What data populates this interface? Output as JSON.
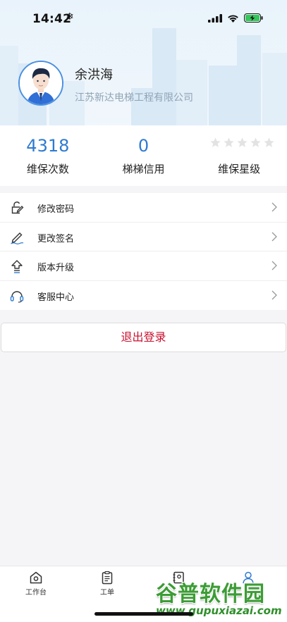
{
  "status_bar": {
    "time": "14:42",
    "extra_icon": "snowflake-icon",
    "icons": [
      "cellular-signal-icon",
      "wifi-icon",
      "battery-charging-icon"
    ]
  },
  "profile": {
    "name": "余洪海",
    "company": "江苏新达电梯工程有限公司",
    "avatar_icon": "user-avatar"
  },
  "stats": {
    "maintenance_count": {
      "value": "4318",
      "label": "维保次数"
    },
    "credit": {
      "value": "0",
      "label": "梯梯信用"
    },
    "rating": {
      "label": "维保星级",
      "stars_total": 5,
      "stars_filled": 0
    }
  },
  "menu": {
    "items": [
      {
        "label": "修改密码",
        "icon": "lock-edit-icon"
      },
      {
        "label": "更改签名",
        "icon": "pen-signature-icon"
      },
      {
        "label": "版本升级",
        "icon": "upgrade-arrow-icon"
      },
      {
        "label": "客服中心",
        "icon": "headset-icon"
      }
    ]
  },
  "logout": {
    "label": "退出登录"
  },
  "tabbar": {
    "tabs": [
      {
        "label": "工作台",
        "icon": "workbench-icon"
      },
      {
        "label": "工单",
        "icon": "clipboard-icon"
      },
      {
        "label": "",
        "icon": "contacts-icon"
      },
      {
        "label": "",
        "icon": "profile-icon"
      }
    ]
  },
  "watermark": {
    "title": "谷普软件园",
    "url": "www.gupuxiazai.com"
  },
  "colors": {
    "accent_blue": "#2e7ad1",
    "logout_red": "#c8102e",
    "header_bg": "#e9f3fb",
    "watermark_green": "#3c9c35"
  }
}
